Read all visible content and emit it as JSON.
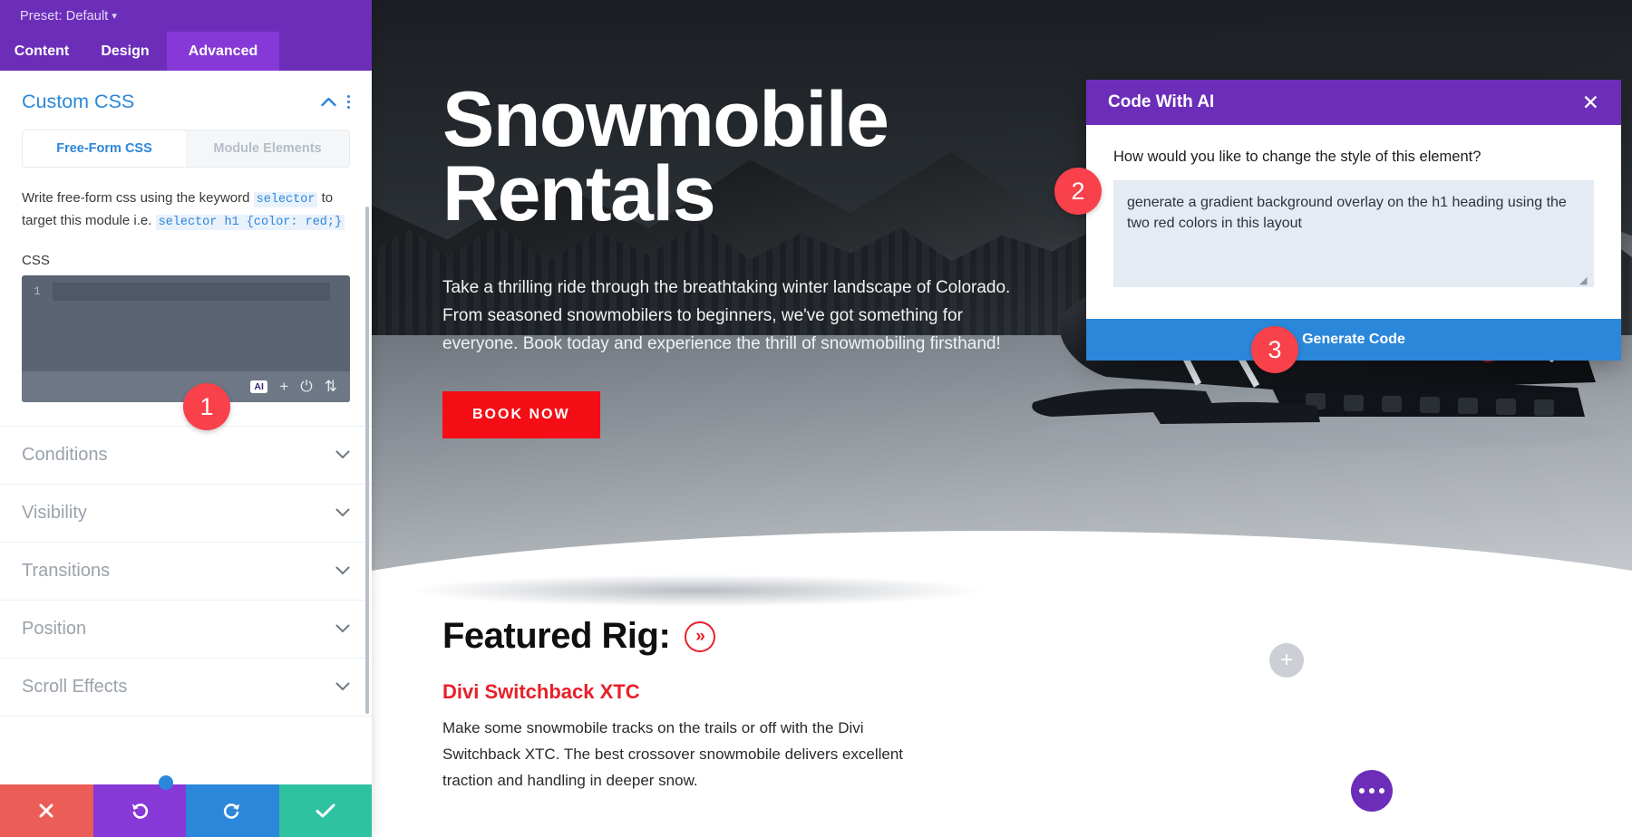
{
  "sidebar": {
    "preset_label": "Preset: Default",
    "preset_caret": "▾",
    "tabs": [
      {
        "label": "Content",
        "active": false
      },
      {
        "label": "Design",
        "active": false
      },
      {
        "label": "Advanced",
        "active": true
      }
    ],
    "panel": {
      "title": "Custom CSS",
      "collapse_icon": "chevron-up-icon",
      "menu_icon": "kebab-menu-icon",
      "segments": [
        {
          "label": "Free-Form CSS",
          "active": true
        },
        {
          "label": "Module Elements",
          "active": false
        }
      ],
      "description": {
        "part1": "Write free-form css using the keyword ",
        "code1": "selector",
        "part2": " to target this module i.e. ",
        "code2": "selector h1 {color: red;}"
      },
      "css_label": "CSS",
      "editor": {
        "line_number": "1",
        "value": "",
        "toolbar": {
          "ai_label": "AI",
          "add_icon": "plus-icon",
          "power_icon": "power-toggle-icon",
          "expand_icon": "expand-arrows-icon"
        }
      }
    },
    "accordions": [
      {
        "label": "Conditions"
      },
      {
        "label": "Visibility"
      },
      {
        "label": "Transitions"
      },
      {
        "label": "Position"
      },
      {
        "label": "Scroll Effects"
      }
    ],
    "footer_buttons": [
      {
        "name": "cancel",
        "icon": "close-x-icon",
        "color": "#eb5d56"
      },
      {
        "name": "undo",
        "icon": "undo-arrow-icon",
        "color": "#8639d6"
      },
      {
        "name": "redo",
        "icon": "redo-arrow-icon",
        "color": "#2b87da"
      },
      {
        "name": "save",
        "icon": "checkmark-icon",
        "color": "#2ec2a0"
      }
    ]
  },
  "page": {
    "hero": {
      "heading": "Snowmobile Rentals",
      "paragraph": "Take a thrilling ride through the breathtaking winter landscape of Colorado. From seasoned snowmobilers to beginners, we've got something for everyone. Book today and experience the thrill of snowmobiling firsthand!",
      "cta_label": "BOOK NOW"
    },
    "featured": {
      "heading": "Featured Rig:",
      "chevron_icon": "double-chevron-right-icon",
      "product_name": "Divi Switchback XTC",
      "product_description": "Make some snowmobile tracks on the trails or off with the Divi Switchback XTC. The best crossover snowmobile delivers excellent traction and handling in deeper snow."
    },
    "floating": {
      "add_module_icon": "plus-icon",
      "page_settings_icon": "ellipsis-icon"
    }
  },
  "modal": {
    "title": "Code With AI",
    "close_icon": "close-x-icon",
    "question": "How would you like to change the style of this element?",
    "prompt_value": "generate a gradient background overlay on the h1 heading using the two red colors in this layout",
    "prompt_placeholder": "",
    "generate_label": "Generate Code"
  },
  "markers": [
    {
      "number": "1",
      "target": "css-editor-ai-button"
    },
    {
      "number": "2",
      "target": "ai-prompt-textarea"
    },
    {
      "number": "3",
      "target": "generate-code-button"
    }
  ],
  "colors": {
    "purple": "#6c2eb9",
    "purple_light": "#8639d6",
    "blue": "#2b87da",
    "red_accent": "#e8202a",
    "red_cta": "#f50d16",
    "marker_red": "#f8414a",
    "green": "#2ec2a0"
  }
}
